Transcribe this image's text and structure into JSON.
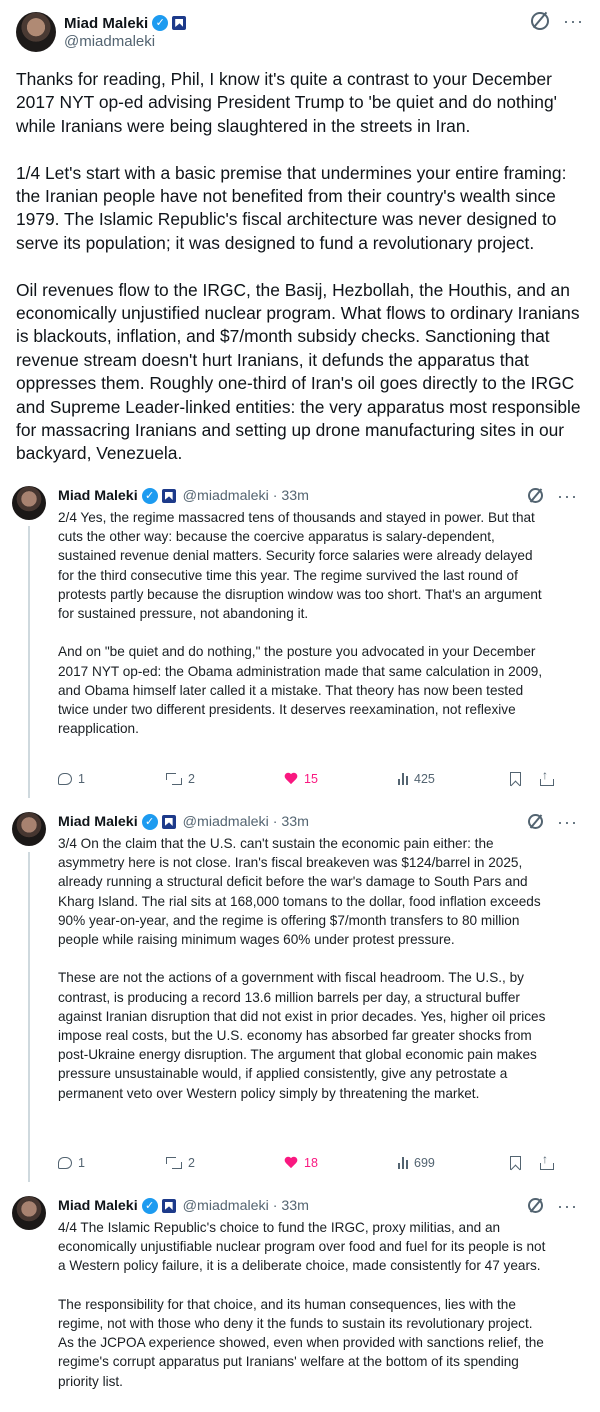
{
  "main": {
    "author_name": "Miad Maleki",
    "author_handle": "@miadmaleki",
    "paragraphs": [
      "Thanks for reading, Phil, I know it's quite a contrast to your December 2017 NYT op-ed advising President Trump to 'be quiet and do nothing' while Iranians were being slaughtered in the streets in Iran.",
      "1/4 Let's start with a basic premise that undermines your entire framing: the Iranian people have not benefited from their country's wealth since 1979. The Islamic Republic's fiscal architecture was never designed to serve its population; it was designed to fund a revolutionary project.",
      "Oil revenues flow to the IRGC, the Basij, Hezbollah, the Houthis, and an economically unjustified nuclear program. What flows to ordinary Iranians is blackouts, inflation, and $7/month subsidy checks. Sanctioning that revenue stream doesn't hurt Iranians, it defunds the apparatus that oppresses them. Roughly one-third of Iran's oil goes directly to the IRGC and Supreme Leader-linked entities: the very apparatus most responsible for massacring Iranians and setting up drone manufacturing sites in our backyard, Venezuela."
    ]
  },
  "replies": [
    {
      "name": "Miad Maleki",
      "meta": "@miadmaleki · 33m",
      "paragraphs": [
        "2/4 Yes, the regime massacred tens of thousands and stayed in power. But that cuts the other way: because the coercive apparatus is salary-dependent, sustained revenue denial matters. Security force salaries were already delayed for the third consecutive time this year. The regime survived the last round of protests partly because the disruption window was too short. That's an argument for sustained pressure, not abandoning it.",
        "And on \"be quiet and do nothing,\" the posture you advocated in your December 2017 NYT op-ed: the Obama administration made that same calculation in 2009, and Obama himself later called it a mistake. That theory has now been tested twice under two different presidents. It deserves reexamination, not reflexive reapplication."
      ],
      "stats": {
        "replies": "1",
        "reposts": "2",
        "likes": "15",
        "views": "425"
      }
    },
    {
      "name": "Miad Maleki",
      "meta": "@miadmaleki · 33m",
      "paragraphs": [
        "3/4 On the claim that the U.S. can't sustain the economic pain either: the asymmetry here is not close. Iran's fiscal breakeven was $124/barrel in 2025, already running a structural deficit before the war's damage to South Pars and Kharg Island. The rial sits at 168,000 tomans to the dollar, food inflation exceeds 90% year-on-year, and the regime is offering $7/month transfers to 80 million people while raising minimum wages 60% under protest pressure.",
        "These are not the actions of a government with fiscal headroom. The U.S., by contrast, is producing a record 13.6 million barrels per day, a structural buffer against Iranian disruption that did not exist in prior decades. Yes, higher oil prices impose real costs, but the U.S. economy has absorbed far greater shocks from post-Ukraine energy disruption. The argument that global economic pain makes pressure unsustainable would, if applied consistently, give any petrostate a permanent veto over Western policy simply by threatening the market."
      ],
      "stats": {
        "replies": "1",
        "reposts": "2",
        "likes": "18",
        "views": "699"
      }
    },
    {
      "name": "Miad Maleki",
      "meta": "@miadmaleki · 33m",
      "paragraphs": [
        "4/4 The Islamic Republic's choice to fund the IRGC, proxy militias, and an economically unjustifiable nuclear program over food and fuel for its people is not a Western policy failure, it is a deliberate choice, made consistently for 47 years.",
        "The responsibility for that choice, and its human consequences, lies with the regime, not with those who deny it the funds to sustain its revolutionary project. As the JCPOA experience showed, even when provided with sanctions relief, the regime's corrupt apparatus put Iranians' welfare at the bottom of its spending priority list."
      ]
    }
  ],
  "icons": {
    "verified": "verified-badge-icon",
    "affiliate": "affiliate-badge-icon",
    "grok": "grok-icon",
    "more": "more-icon",
    "reply": "reply-icon",
    "repost": "repost-icon",
    "like": "heart-icon",
    "views": "views-icon",
    "bookmark": "bookmark-icon",
    "share": "share-icon"
  },
  "colors": {
    "verified": "#1d9bf0",
    "like": "#f91880",
    "secondary_text": "#536471"
  }
}
